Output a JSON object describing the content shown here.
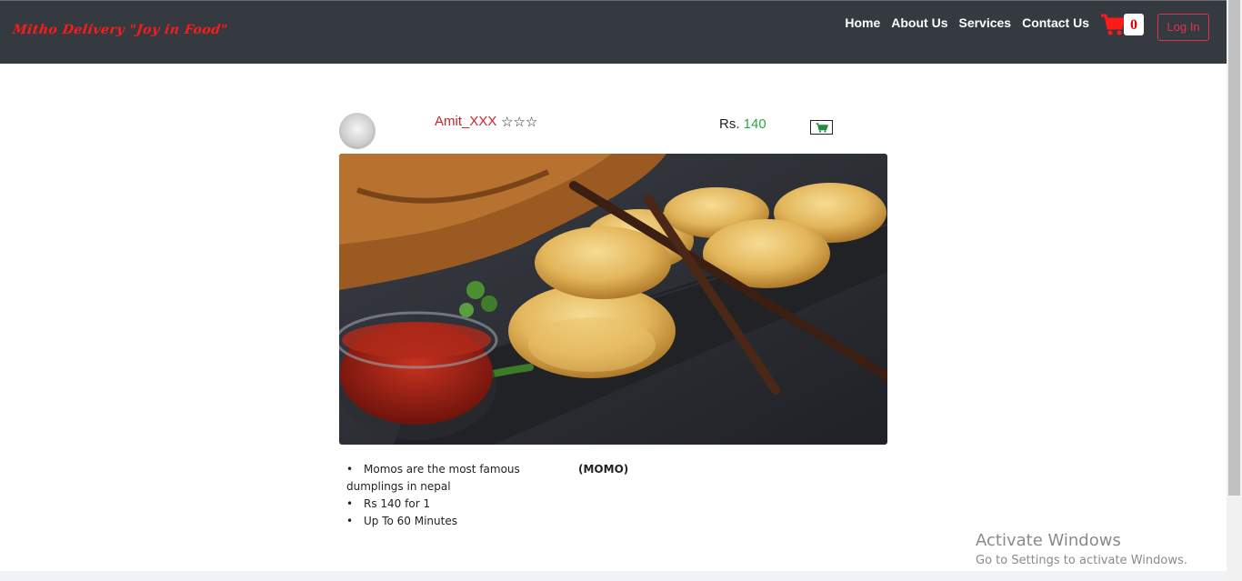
{
  "navbar": {
    "brand": "Mitho Delivery \"Joy in Food\"",
    "links": [
      "Home",
      "About Us",
      "Services",
      "Contact Us"
    ],
    "cart_count": "0",
    "login_label": "Log In"
  },
  "post": {
    "username": "Amit_XXX",
    "avatar_text": "",
    "rating_stars": 3,
    "price_label": "Rs.",
    "price_value": "140",
    "features": [
      "Momos are the most famous dumplings in nepal",
      "Rs 140 for 1",
      "Up To 60 Minutes"
    ],
    "dish_name": "(MOMO)"
  },
  "colors": {
    "navbar_bg": "#343a40",
    "brand": "#ff1a1a",
    "accent_red": "#dc3545",
    "price_green": "#28a745"
  },
  "icons": [
    "shopping-cart-icon",
    "star-outline-icon",
    "add-to-cart-icon"
  ],
  "watermark": {
    "title": "Activate Windows",
    "subtitle": "Go to Settings to activate Windows."
  }
}
